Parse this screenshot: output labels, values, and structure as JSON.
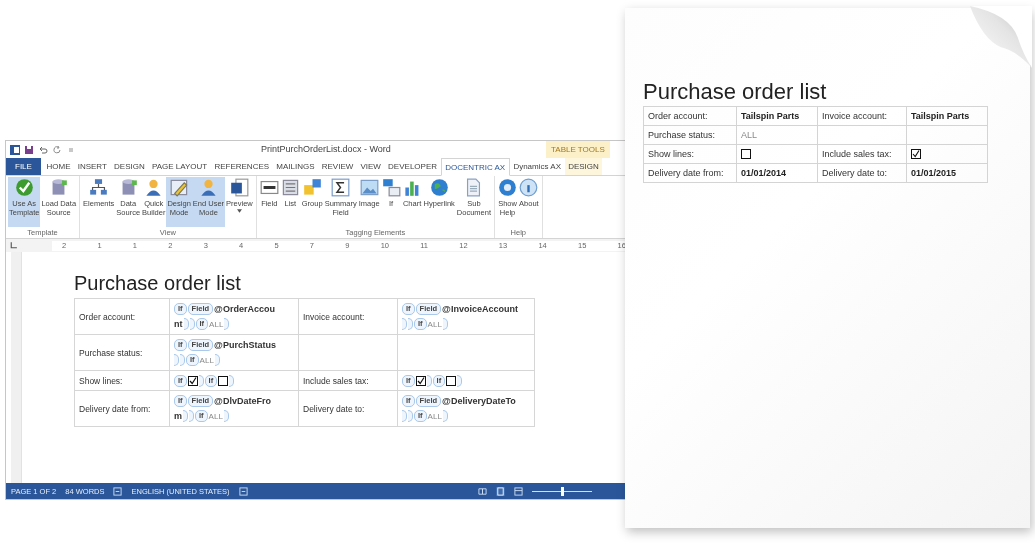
{
  "word": {
    "title": "PrintPurchOrderList.docx - Word",
    "contextual_group": "TABLE TOOLS",
    "tabs": [
      {
        "label": "FILE",
        "kind": "file",
        "selected": false
      },
      {
        "label": "HOME",
        "kind": "tab",
        "selected": false
      },
      {
        "label": "INSERT",
        "kind": "tab",
        "selected": false
      },
      {
        "label": "DESIGN",
        "kind": "tab",
        "selected": false
      },
      {
        "label": "PAGE LAYOUT",
        "kind": "tab",
        "selected": false
      },
      {
        "label": "REFERENCES",
        "kind": "tab",
        "selected": false
      },
      {
        "label": "MAILINGS",
        "kind": "tab",
        "selected": false
      },
      {
        "label": "REVIEW",
        "kind": "tab",
        "selected": false
      },
      {
        "label": "VIEW",
        "kind": "tab",
        "selected": false
      },
      {
        "label": "DEVELOPER",
        "kind": "tab",
        "selected": false
      },
      {
        "label": "DOCENTRIC AX",
        "kind": "tab",
        "selected": true
      },
      {
        "label": "Dynamics AX",
        "kind": "tab",
        "selected": false
      },
      {
        "label": "DESIGN",
        "kind": "contextual",
        "selected": false
      }
    ],
    "ribbon_groups": [
      {
        "label": "Template",
        "buttons": [
          {
            "label": "Use As\nTemplate",
            "pressed": true,
            "dropdown": false
          },
          {
            "label": "Load Data\nSource",
            "pressed": false,
            "dropdown": false
          }
        ]
      },
      {
        "label": "View",
        "buttons": [
          {
            "label": "Elements",
            "pressed": false,
            "dropdown": false
          },
          {
            "label": "Data\nSource",
            "pressed": false,
            "dropdown": false
          },
          {
            "label": "Quick\nBuilder",
            "pressed": false,
            "dropdown": false
          },
          {
            "label": "Design\nMode",
            "pressed": true,
            "dropdown": false
          },
          {
            "label": "End User\nMode",
            "pressed": true,
            "dropdown": false
          },
          {
            "label": "Preview",
            "pressed": false,
            "dropdown": true
          }
        ]
      },
      {
        "label": "Tagging Elements",
        "buttons": [
          {
            "label": "Field",
            "pressed": false,
            "dropdown": false
          },
          {
            "label": "List",
            "pressed": false,
            "dropdown": false
          },
          {
            "label": "Group",
            "pressed": false,
            "dropdown": false
          },
          {
            "label": "Summary\nField",
            "pressed": false,
            "dropdown": false
          },
          {
            "label": "Image",
            "pressed": false,
            "dropdown": false
          },
          {
            "label": "If",
            "pressed": false,
            "dropdown": false
          },
          {
            "label": "Chart",
            "pressed": false,
            "dropdown": false
          },
          {
            "label": "Hyperlink",
            "pressed": false,
            "dropdown": false
          },
          {
            "label": "Sub\nDocument",
            "pressed": false,
            "dropdown": false
          }
        ]
      },
      {
        "label": "Help",
        "buttons": [
          {
            "label": "Show\nHelp",
            "pressed": false,
            "dropdown": false
          },
          {
            "label": "About",
            "pressed": false,
            "dropdown": false
          }
        ]
      }
    ],
    "ruler_numbers": [
      "2",
      "1",
      "1",
      "2",
      "3",
      "4",
      "5",
      "7",
      "9",
      "10",
      "11",
      "12",
      "13",
      "14",
      "15",
      "16"
    ],
    "document": {
      "title": "Purchase order list",
      "rows": [
        {
          "cells": [
            {
              "kind": "label",
              "text": "Order account:"
            },
            {
              "kind": "template",
              "lines": [
                [
                  {
                    "kind": "tag",
                    "label": "If"
                  },
                  {
                    "kind": "tag",
                    "label": "Field"
                  },
                  {
                    "kind": "text",
                    "text": "@OrderAccou"
                  }
                ],
                [
                  {
                    "kind": "text",
                    "text": "nt"
                  },
                  {
                    "kind": "close"
                  },
                  {
                    "kind": "close"
                  },
                  {
                    "kind": "tag",
                    "label": "If"
                  },
                  {
                    "kind": "muted",
                    "text": "ALL"
                  },
                  {
                    "kind": "close"
                  }
                ]
              ]
            },
            {
              "kind": "label",
              "text": "Invoice account:"
            },
            {
              "kind": "template",
              "lines": [
                [
                  {
                    "kind": "tag",
                    "label": "If"
                  },
                  {
                    "kind": "tag",
                    "label": "Field"
                  },
                  {
                    "kind": "text",
                    "text": "@InvoiceAccount"
                  }
                ],
                [
                  {
                    "kind": "close"
                  },
                  {
                    "kind": "close"
                  },
                  {
                    "kind": "tag",
                    "label": "If"
                  },
                  {
                    "kind": "muted",
                    "text": "ALL"
                  },
                  {
                    "kind": "close"
                  }
                ]
              ]
            }
          ]
        },
        {
          "cells": [
            {
              "kind": "label",
              "text": "Purchase status:"
            },
            {
              "kind": "template",
              "lines": [
                [
                  {
                    "kind": "tag",
                    "label": "If"
                  },
                  {
                    "kind": "tag",
                    "label": "Field"
                  },
                  {
                    "kind": "text",
                    "text": "@PurchStatus"
                  }
                ],
                [
                  {
                    "kind": "close"
                  },
                  {
                    "kind": "close"
                  },
                  {
                    "kind": "tag",
                    "label": "If"
                  },
                  {
                    "kind": "muted",
                    "text": "ALL"
                  },
                  {
                    "kind": "close"
                  }
                ]
              ]
            },
            {
              "kind": "empty"
            },
            {
              "kind": "empty"
            }
          ]
        },
        {
          "cells": [
            {
              "kind": "label",
              "text": "Show lines:"
            },
            {
              "kind": "template",
              "lines": [
                [
                  {
                    "kind": "tag",
                    "label": "If"
                  },
                  {
                    "kind": "checkbox",
                    "checked": true
                  },
                  {
                    "kind": "close"
                  },
                  {
                    "kind": "tag",
                    "label": "If"
                  },
                  {
                    "kind": "checkbox",
                    "checked": false
                  },
                  {
                    "kind": "close"
                  }
                ]
              ]
            },
            {
              "kind": "label",
              "text": "Include sales tax:"
            },
            {
              "kind": "template",
              "lines": [
                [
                  {
                    "kind": "tag",
                    "label": "If"
                  },
                  {
                    "kind": "checkbox",
                    "checked": true
                  },
                  {
                    "kind": "close"
                  },
                  {
                    "kind": "tag",
                    "label": "If"
                  },
                  {
                    "kind": "checkbox",
                    "checked": false
                  },
                  {
                    "kind": "close"
                  }
                ]
              ]
            }
          ]
        },
        {
          "cells": [
            {
              "kind": "label",
              "text": "Delivery date from:"
            },
            {
              "kind": "template",
              "lines": [
                [
                  {
                    "kind": "tag",
                    "label": "If"
                  },
                  {
                    "kind": "tag",
                    "label": "Field"
                  },
                  {
                    "kind": "text",
                    "text": "@DlvDateFro"
                  }
                ],
                [
                  {
                    "kind": "text",
                    "text": "m"
                  },
                  {
                    "kind": "close"
                  },
                  {
                    "kind": "close"
                  },
                  {
                    "kind": "tag",
                    "label": "If"
                  },
                  {
                    "kind": "muted",
                    "text": "ALL"
                  },
                  {
                    "kind": "close"
                  }
                ]
              ]
            },
            {
              "kind": "label",
              "text": "Delivery date to:"
            },
            {
              "kind": "template",
              "lines": [
                [
                  {
                    "kind": "tag",
                    "label": "If"
                  },
                  {
                    "kind": "tag",
                    "label": "Field"
                  },
                  {
                    "kind": "text",
                    "text": "@DeliveryDateTo"
                  }
                ],
                [
                  {
                    "kind": "close"
                  },
                  {
                    "kind": "close"
                  },
                  {
                    "kind": "tag",
                    "label": "If"
                  },
                  {
                    "kind": "muted",
                    "text": "ALL"
                  },
                  {
                    "kind": "close"
                  }
                ]
              ]
            }
          ]
        }
      ]
    },
    "zoom_slider": {
      "level": 0.5
    },
    "status_bar": [
      {
        "kind": "text",
        "text": "PAGE 1 OF 2"
      },
      {
        "kind": "text",
        "text": "84 WORDS"
      },
      {
        "kind": "icon"
      },
      {
        "kind": "text",
        "text": "ENGLISH (UNITED STATES)"
      },
      {
        "kind": "icon"
      }
    ]
  },
  "page": {
    "title": "Purchase order list",
    "rows": [
      {
        "cells": [
          {
            "kind": "label",
            "text": "Order account:"
          },
          {
            "kind": "value",
            "text": "Tailspin Parts"
          },
          {
            "kind": "label",
            "text": "Invoice account:"
          },
          {
            "kind": "value",
            "text": "Tailspin Parts"
          }
        ]
      },
      {
        "cells": [
          {
            "kind": "label",
            "text": "Purchase status:"
          },
          {
            "kind": "muted",
            "text": "ALL"
          },
          {
            "kind": "empty"
          },
          {
            "kind": "empty"
          }
        ]
      },
      {
        "cells": [
          {
            "kind": "label",
            "text": "Show lines:"
          },
          {
            "kind": "checkbox",
            "checked": false
          },
          {
            "kind": "label",
            "text": "Include sales tax:"
          },
          {
            "kind": "checkbox",
            "checked": true
          }
        ]
      },
      {
        "cells": [
          {
            "kind": "label",
            "text": "Delivery date from:"
          },
          {
            "kind": "value",
            "text": "01/01/2014"
          },
          {
            "kind": "label",
            "text": "Delivery date to:"
          },
          {
            "kind": "value",
            "text": "01/01/2015"
          }
        ]
      }
    ]
  }
}
